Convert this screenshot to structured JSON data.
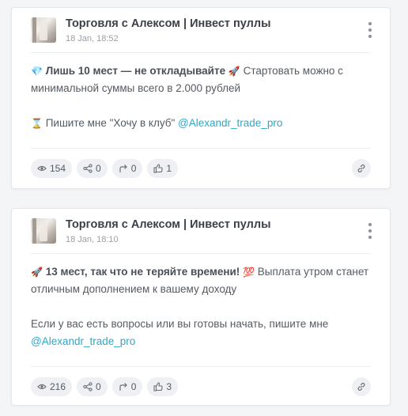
{
  "posts": [
    {
      "channel": "Торговля с Алексом | Инвест пуллы",
      "date": "18 Jan, 18:52",
      "line1_emoji": "💎",
      "line1_bold": "Лишь 10 мест — не откладывайте",
      "line1_emoji2": "🚀",
      "line1_rest": " Стартовать можно с минимальной суммы всего в 2.000 рублей",
      "line2_emoji": "⌛",
      "line2_text": "Пишите мне \"Хочу в клуб\" ",
      "line2_link": "@Alexandr_trade_pro",
      "stats": {
        "views": "154",
        "shares": "0",
        "forwards": "0",
        "reactions": "1"
      }
    },
    {
      "channel": "Торговля с Алексом | Инвест пуллы",
      "date": "18 Jan, 18:10",
      "line1_emoji": "🚀",
      "line1_bold": "13 мест, так что не теряйте времени!",
      "line1_emoji2": "💯",
      "line1_rest": " Выплата утром станет отличным дополнением к вашему доходу",
      "line2_text": "Если у вас есть вопросы или вы готовы начать, пишите мне ",
      "line2_link": "@Alexandr_trade_pro",
      "stats": {
        "views": "216",
        "shares": "0",
        "forwards": "0",
        "reactions": "3"
      }
    }
  ],
  "icons": {
    "views": "eye-icon",
    "shares": "share-icon",
    "forwards": "forward-icon",
    "reactions": "thumbs-up-icon",
    "link": "link-icon",
    "menu": "kebab-menu-icon"
  },
  "colors": {
    "link": "#2fa7c9",
    "pill_bg": "#eef0f3",
    "page_bg": "#f4f5f7"
  }
}
